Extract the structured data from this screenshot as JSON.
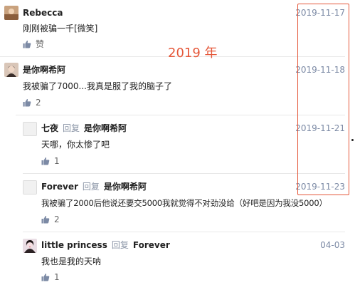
{
  "annotation": {
    "year_label": "2019 年",
    "frame_color": "#e5583a"
  },
  "colors": {
    "date": "#7c8aa5",
    "reply_label": "#8a94a6",
    "separator": "#e8e8e8"
  },
  "comments": [
    {
      "name": "Rebecca",
      "date": "2019-11-17",
      "text": "刚刚被骗一千[微笑]",
      "like_label": "赞",
      "avatar": "avatar-photo"
    },
    {
      "name": "是你啊希阿",
      "date": "2019-11-18",
      "text": "我被骗了7000...我真是服了我的脑子了",
      "like_count": "2",
      "avatar": "avatar-photo"
    },
    {
      "name": "七夜",
      "reply_label": "回复",
      "reply_target": "是你啊希阿",
      "date": "2019-11-21",
      "text": "天哪，你太惨了吧",
      "like_count": "1",
      "avatar": "avatar-placeholder"
    },
    {
      "name": "Forever",
      "reply_label": "回复",
      "reply_target": "是你啊希阿",
      "date": "2019-11-23",
      "text": "我被骗了2000后他说还要交5000我就觉得不对劲没给（好吧是因为我没5000）",
      "like_count": "2",
      "avatar": "avatar-placeholder"
    },
    {
      "name": "little princess",
      "reply_label": "回复",
      "reply_target": "Forever",
      "date": "04-03",
      "text": "我也是我的天呐",
      "like_count": "1",
      "avatar": "avatar-photo"
    }
  ]
}
